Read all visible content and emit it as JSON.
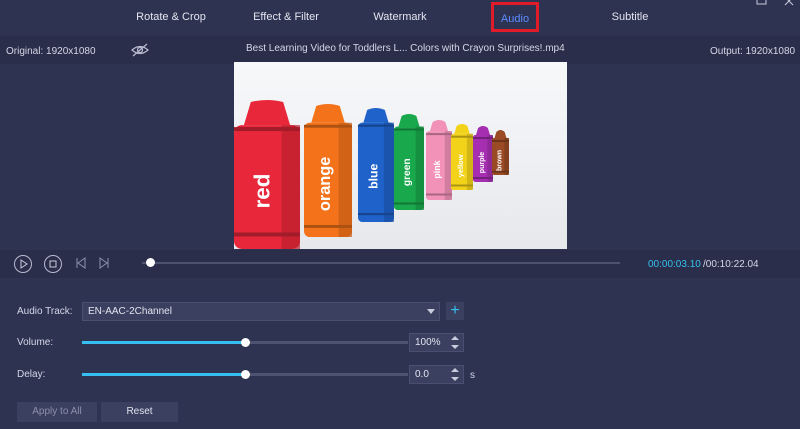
{
  "tabs": [
    {
      "label": "Rotate & Crop"
    },
    {
      "label": "Effect & Filter"
    },
    {
      "label": "Watermark"
    },
    {
      "label": "Audio"
    },
    {
      "label": "Subtitle"
    }
  ],
  "active_tab": "Audio",
  "info": {
    "original": "Original: 1920x1080",
    "filename": "Best Learning Video for Toddlers L... Colors with Crayon Surprises!.mp4",
    "output": "Output: 1920x1080"
  },
  "preview": {
    "crayons": [
      "red",
      "orange",
      "blue",
      "green",
      "pink",
      "yellow",
      "purple",
      "brown"
    ],
    "colors": [
      "#e8283a",
      "#f4731a",
      "#1f62c9",
      "#19a84b",
      "#f292b8",
      "#f3d31a",
      "#a52fb0",
      "#9a4a24"
    ]
  },
  "playback": {
    "current_time": "00:00:03.10",
    "total_time": "/00:10:22.04",
    "progress": 0.01
  },
  "audio": {
    "track_label": "Audio Track:",
    "track_value": "EN-AAC-2Channel",
    "add_label": "+",
    "volume_label": "Volume:",
    "volume_value": "100%",
    "volume_level": 0.5,
    "delay_label": "Delay:",
    "delay_value": "0.0",
    "delay_level": 0.5,
    "delay_unit": "s"
  },
  "buttons": {
    "apply_all": "Apply to All",
    "reset": "Reset"
  },
  "colors": {
    "accent": "#35c0f0",
    "active_tab_text": "#5b8cff",
    "highlight_border": "#e01b2a",
    "background": "#2f3352"
  }
}
